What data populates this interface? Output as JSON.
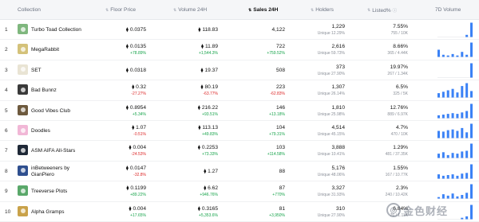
{
  "header": {
    "collection": "Collection",
    "floor_price": "Floor Price",
    "volume_24h": "Volume 24H",
    "sales_24h": "Sales 24H",
    "holders": "Holders",
    "listed": "Listed%",
    "volume_7d": "7D Volume"
  },
  "rows": [
    {
      "rank": "1",
      "name": "Turbo Toad Collection",
      "floor": "0.0375",
      "floor_chg": "",
      "vol": "118.83",
      "vol_chg": "",
      "sales": "4,122",
      "sales_chg": "",
      "holders": "1,229",
      "unique": "Unique 12.29%",
      "listed": "7.55%",
      "listed_sub": "755 / 10K",
      "avatar_color": "#7fb77e",
      "bars": [
        0,
        0,
        0,
        0,
        0,
        0,
        0.15,
        1
      ]
    },
    {
      "rank": "2",
      "name": "MegaRabbit",
      "floor": "0.0135",
      "floor_chg": "+78.89%",
      "vol": "11.89",
      "vol_chg": "+1,544.3%",
      "sales": "722",
      "sales_chg": "+759.52%",
      "holders": "2,616",
      "unique": "Unique 59.73%",
      "listed": "8.66%",
      "listed_sub": "365 / 4.44K",
      "avatar_color": "#d4c27a",
      "bars": [
        0.5,
        0.15,
        0.1,
        0.2,
        0.1,
        0.35,
        0.15,
        1
      ]
    },
    {
      "rank": "3",
      "name": "SET",
      "floor": "0.0318",
      "floor_chg": "",
      "vol": "19.37",
      "vol_chg": "",
      "sales": "508",
      "sales_chg": "",
      "holders": "373",
      "unique": "Unique 27.90%",
      "listed": "19.97%",
      "listed_sub": "267 / 1.34K",
      "avatar_color": "#e9e4d4",
      "bars": [
        0,
        0,
        0,
        0,
        0,
        0,
        0,
        1
      ]
    },
    {
      "rank": "4",
      "name": "Bad Bunnz",
      "floor": "0.32",
      "floor_chg": "-27.27%",
      "vol": "80.19",
      "vol_chg": "-63.77%",
      "sales": "223",
      "sales_chg": "-62.83%",
      "holders": "1,307",
      "unique": "Unique 26.14%",
      "listed": "6.5%",
      "listed_sub": "325 / 5K",
      "avatar_color": "#3a3a3a",
      "bars": [
        0.3,
        0.4,
        0.5,
        0.6,
        0.35,
        0.8,
        1,
        0.45
      ]
    },
    {
      "rank": "5",
      "name": "Good Vibes Club",
      "floor": "0.8954",
      "floor_chg": "+5.34%",
      "vol": "216.22",
      "vol_chg": "+93.51%",
      "sales": "146",
      "sales_chg": "+13.18%",
      "holders": "1,810",
      "unique": "Unique 25.98%",
      "listed": "12.76%",
      "listed_sub": "889 / 6.97K",
      "avatar_color": "#6e5a3e",
      "bars": [
        0.2,
        0.25,
        0.3,
        0.35,
        0.3,
        0.4,
        0.5,
        1
      ]
    },
    {
      "rank": "6",
      "name": "Doodles",
      "floor": "1.07",
      "floor_chg": "-0.51%",
      "vol": "113.13",
      "vol_chg": "+49.83%",
      "sales": "104",
      "sales_chg": "+79.31%",
      "holders": "4,514",
      "unique": "Unique 45.15%",
      "listed": "4.7%",
      "listed_sub": "470 / 10K",
      "avatar_color": "#f1b7d6",
      "bars": [
        0.5,
        0.45,
        0.55,
        0.6,
        0.5,
        0.7,
        0.4,
        1
      ]
    },
    {
      "rank": "7",
      "name": "ASM AIFA All-Stars",
      "floor": "0.004",
      "floor_chg": "-24.53%",
      "vol": "0.2253",
      "vol_chg": "+73.33%",
      "sales": "103",
      "sales_chg": "+114.58%",
      "holders": "3,888",
      "unique": "Unique 10.41%",
      "listed": "1.29%",
      "listed_sub": "481 / 37.35K",
      "avatar_color": "#1f2937",
      "bars": [
        0.3,
        0.4,
        0.2,
        0.35,
        0.3,
        0.45,
        0.5,
        1
      ]
    },
    {
      "rank": "8",
      "name": "inBetweeners by GianPiero",
      "floor": "0.0147",
      "floor_chg": "-32.8%",
      "vol": "1.27",
      "vol_chg": "",
      "sales": "88",
      "sales_chg": "",
      "holders": "5,176",
      "unique": "Unique 48.06%",
      "listed": "1.55%",
      "listed_sub": "167 / 10.77K",
      "avatar_color": "#2f4f8f",
      "bars": [
        0.3,
        0.2,
        0.25,
        0.3,
        0.2,
        0.35,
        0.4,
        1
      ]
    },
    {
      "rank": "9",
      "name": "Treeverse Plots",
      "floor": "0.1199",
      "floor_chg": "+89.22%",
      "vol": "6.62",
      "vol_chg": "+946.76%",
      "sales": "87",
      "sales_chg": "+770%",
      "holders": "3,327",
      "unique": "Unique 31.93%",
      "listed": "2.3%",
      "listed_sub": "240 / 10.42K",
      "avatar_color": "#5aa86a",
      "bars": [
        0.1,
        0.3,
        0.2,
        0.35,
        0.15,
        0.25,
        0.4,
        1
      ]
    },
    {
      "rank": "10",
      "name": "Alpha Gramps",
      "floor": "0.004",
      "floor_chg": "+17.65%",
      "vol": "0.3165",
      "vol_chg": "+5,353.6%",
      "sales": "81",
      "sales_chg": "+3,950%",
      "holders": "310",
      "unique": "Unique 27.90%",
      "listed": "6.84%",
      "listed_sub": "76 / 1.11K",
      "avatar_color": "#c9a24a",
      "bars": [
        0,
        0,
        0,
        0,
        0,
        0.1,
        0.2,
        1
      ]
    }
  ],
  "watermark": "金色财经",
  "colors": {
    "positive": "#16a34a",
    "negative": "#dc2626",
    "bar": "#3b82f6"
  }
}
